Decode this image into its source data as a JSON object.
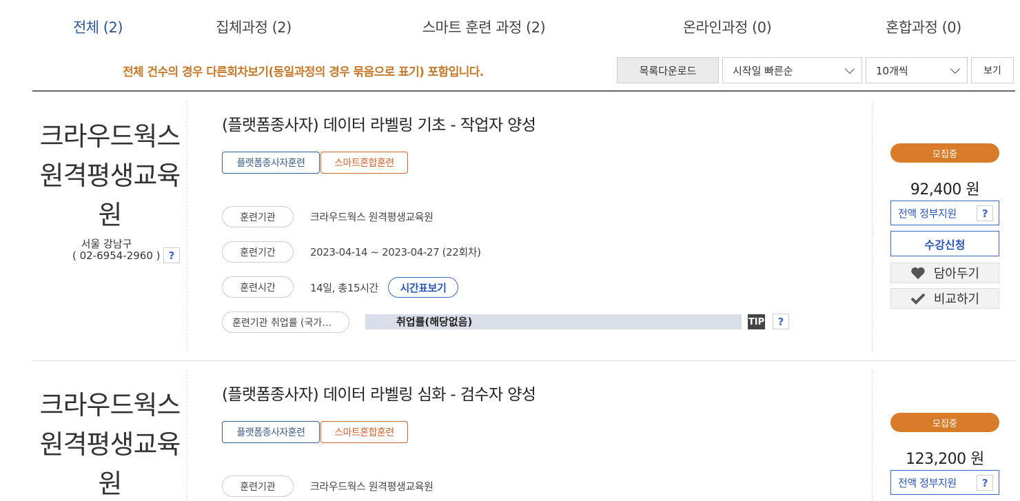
{
  "tabs": [
    {
      "label": "전체 (2)",
      "active": true
    },
    {
      "label": "집체과정 (2)",
      "active": false
    },
    {
      "label": "스마트 훈련 과정 (2)",
      "active": false
    },
    {
      "label": "온라인과정 (0)",
      "active": false
    },
    {
      "label": "혼합과정 (0)",
      "active": false
    }
  ],
  "notice": "전체 건수의 경우 다른회차보기(동일과정의 경우 묶음으로 표기) 포함입니다.",
  "toolbar": {
    "download_label": "목록다운로드",
    "sort_value": "시작일 빠른순",
    "count_value": "10개씩",
    "view_label": "보기"
  },
  "courses": [
    {
      "org_name": "크라우드웍스 원격평생교육원",
      "org_region": "서울 강남구",
      "org_phone": "( 02-6954-2960 )",
      "title": "(플랫폼종사자) 데이터 라벨링 기초 - 작업자 양성",
      "badges": [
        "플랫폼종사자훈련",
        "스마트혼합훈련"
      ],
      "institution_label": "훈련기관",
      "institution_value": "크라우드웍스 원격평생교육원",
      "period_label": "훈련기간",
      "period_value": "2023-04-14 ~ 2023-04-27 (22회차)",
      "time_label": "훈련시간",
      "time_value": "14일, 총15시간",
      "timetable_label": "시간표보기",
      "employment_label": "훈련기관 취업률 (국가…",
      "employment_value": "취업률(해당없음)",
      "tip_label": "TIP",
      "status": "모집중",
      "price": "92,400 원",
      "support_label": "전액 정부지원",
      "apply_label": "수강신청",
      "save_label": "담아두기",
      "compare_label": "비교하기"
    },
    {
      "org_name": "크라우드웍스 원격평생교육원",
      "title": "(플랫폼종사자) 데이터 라벨링 심화 - 검수자 양성",
      "badges": [
        "플랫폼종사자훈련",
        "스마트혼합훈련"
      ],
      "institution_label": "훈련기관",
      "institution_value": "크라우드웍스 원격평생교육원",
      "status": "모집중",
      "price": "123,200 원",
      "support_label": "전액 정부지원"
    }
  ],
  "help_mark": "?",
  "colors": {
    "accent_blue": "#2a55b8",
    "status_orange": "#d87c2a",
    "notice_orange": "#c7792a",
    "badge_blue": "#3a5e8c",
    "badge_orange": "#d4622d"
  }
}
